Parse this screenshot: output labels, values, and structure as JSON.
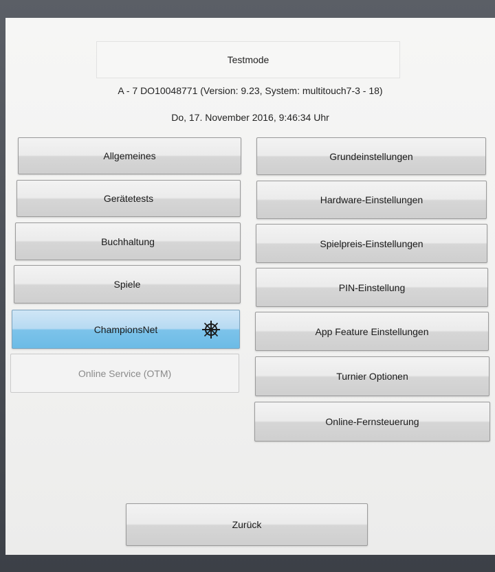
{
  "header": {
    "title": "Testmode",
    "device_info": "A - 7 DO10048771 (Version: 9.23, System: multitouch7-3 - 18)",
    "datetime": "Do, 17. November 2016,  9:46:34 Uhr"
  },
  "left_menu": [
    {
      "label": "Allgemeines",
      "state": "normal"
    },
    {
      "label": "Gerätetests",
      "state": "normal"
    },
    {
      "label": "Buchhaltung",
      "state": "normal"
    },
    {
      "label": "Spiele",
      "state": "normal"
    },
    {
      "label": "ChampionsNet",
      "state": "active",
      "icon": "ship-wheel-icon"
    },
    {
      "label": "Online Service (OTM)",
      "state": "disabled"
    }
  ],
  "right_menu": [
    {
      "label": "Grundeinstellungen"
    },
    {
      "label": "Hardware-Einstellungen"
    },
    {
      "label": "Spielpreis-Einstellungen"
    },
    {
      "label": "PIN-Einstellung"
    },
    {
      "label": "App Feature Einstellungen"
    },
    {
      "label": "Turnier Optionen"
    },
    {
      "label": "Online-Fernsteuerung"
    }
  ],
  "footer": {
    "back_label": "Zurück"
  },
  "colors": {
    "active_button": "#7cc3ea",
    "screen_background": "#f2f2f1",
    "frame_background": "#4a4e55"
  }
}
